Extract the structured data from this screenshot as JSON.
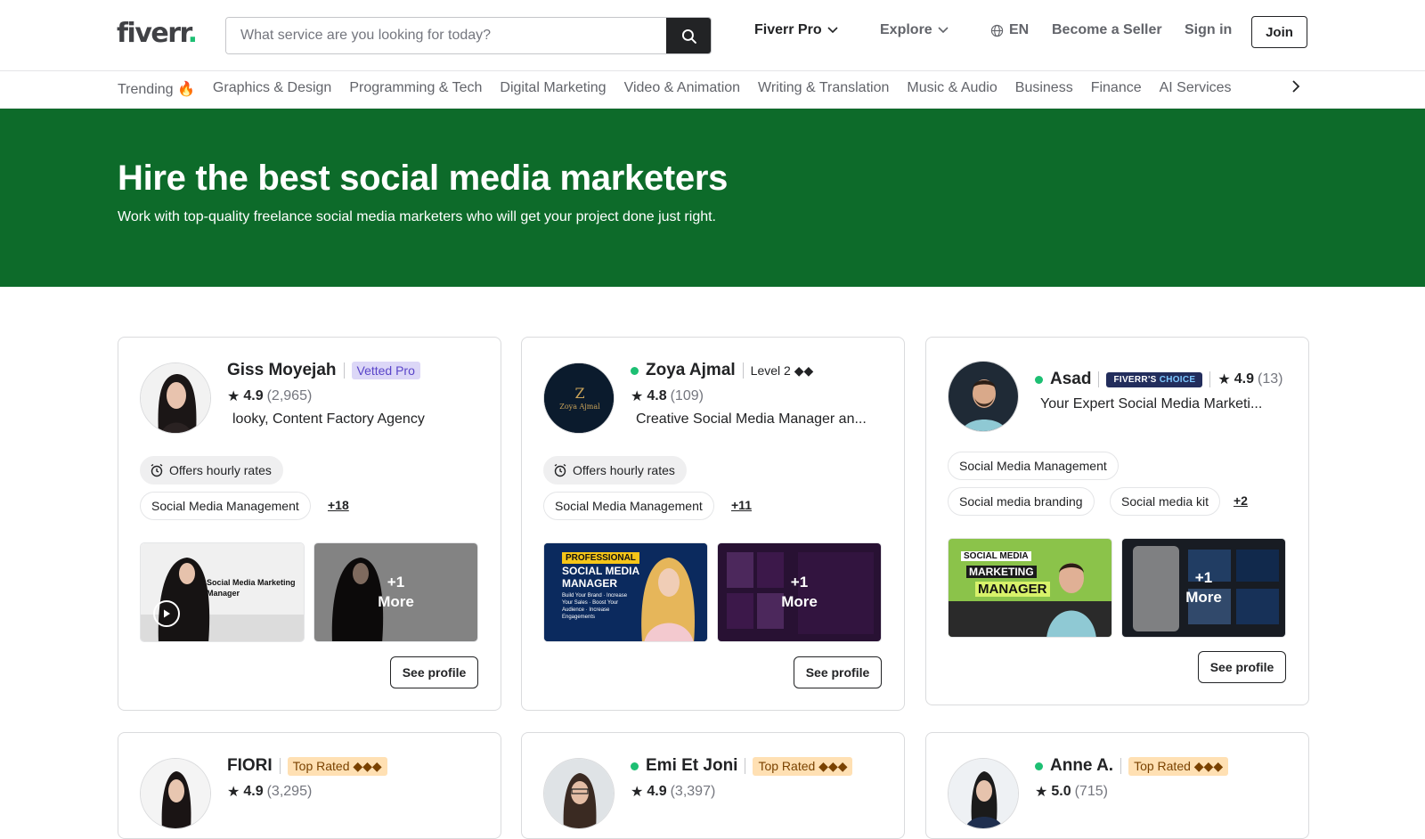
{
  "header": {
    "logo_text": "fiverr",
    "logo_dot": ".",
    "search_placeholder": "What service are you looking for today?",
    "nav": {
      "fiverr_pro": "Fiverr Pro",
      "explore": "Explore",
      "language": "EN",
      "become_seller": "Become a Seller",
      "sign_in": "Sign in",
      "join": "Join"
    }
  },
  "categories": [
    "Trending 🔥",
    "Graphics & Design",
    "Programming & Tech",
    "Digital Marketing",
    "Video & Animation",
    "Writing & Translation",
    "Music & Audio",
    "Business",
    "Finance",
    "AI Services"
  ],
  "hero": {
    "title": "Hire the best social media marketers",
    "subtitle": "Work with top-quality freelance social media marketers who will get your project done just right.",
    "background_color": "#0d6b2a"
  },
  "colors": {
    "brand_green": "#1dbf73",
    "dark_text": "#222325",
    "muted_text": "#74767e"
  },
  "cards": [
    {
      "name": "Giss Moyejah",
      "badge": "Vetted Pro",
      "rating": "4.9",
      "reviews": "(2,965)",
      "tagline": "looky, Content Factory Agency",
      "hourly": "Offers hourly rates",
      "skill": "Social Media Management",
      "more_skills": "+18",
      "thumb_text": "Social Media Marketing Manager",
      "more_count": "+1",
      "more_label": "More",
      "see_profile": "See profile"
    },
    {
      "name": "Zoya Ajmal",
      "badge": "Level 2 ◆◆",
      "rating": "4.8",
      "reviews": "(109)",
      "tagline": "Creative Social Media Manager an...",
      "hourly": "Offers hourly rates",
      "skill": "Social Media Management",
      "more_skills": "+11",
      "avatar_text": "Zoya Ajmal",
      "thumb_text1": "PROFESSIONAL",
      "thumb_text2": "SOCIAL MEDIA MANAGER",
      "thumb_bullets": "Build Your Brand · Increase Your Sales · Boost Your Audience · Increase Engagements",
      "more_count": "+1",
      "more_label": "More",
      "see_profile": "See profile"
    },
    {
      "name": "Asad",
      "badge_a": "FIVERR'S",
      "badge_b": "CHOICE",
      "rating": "4.9",
      "reviews": "(13)",
      "tagline": "Your Expert Social Media Marketi...",
      "skill1": "Social Media Management",
      "skill2": "Social media branding",
      "skill3": "Social media kit",
      "more_skills": "+2",
      "thumb_text1": "SOCIAL MEDIA",
      "thumb_text2": "MARKETING",
      "thumb_text3": "MANAGER",
      "more_count": "+1",
      "more_label": "More",
      "see_profile": "See profile"
    },
    {
      "name": "FIORI",
      "badge": "Top Rated ◆◆◆",
      "rating": "4.9",
      "reviews": "(3,295)"
    },
    {
      "name": "Emi Et Joni",
      "badge": "Top Rated ◆◆◆",
      "rating": "4.9",
      "reviews": "(3,397)"
    },
    {
      "name": "Anne A.",
      "badge": "Top Rated ◆◆◆",
      "rating": "5.0",
      "reviews": "(715)"
    }
  ]
}
